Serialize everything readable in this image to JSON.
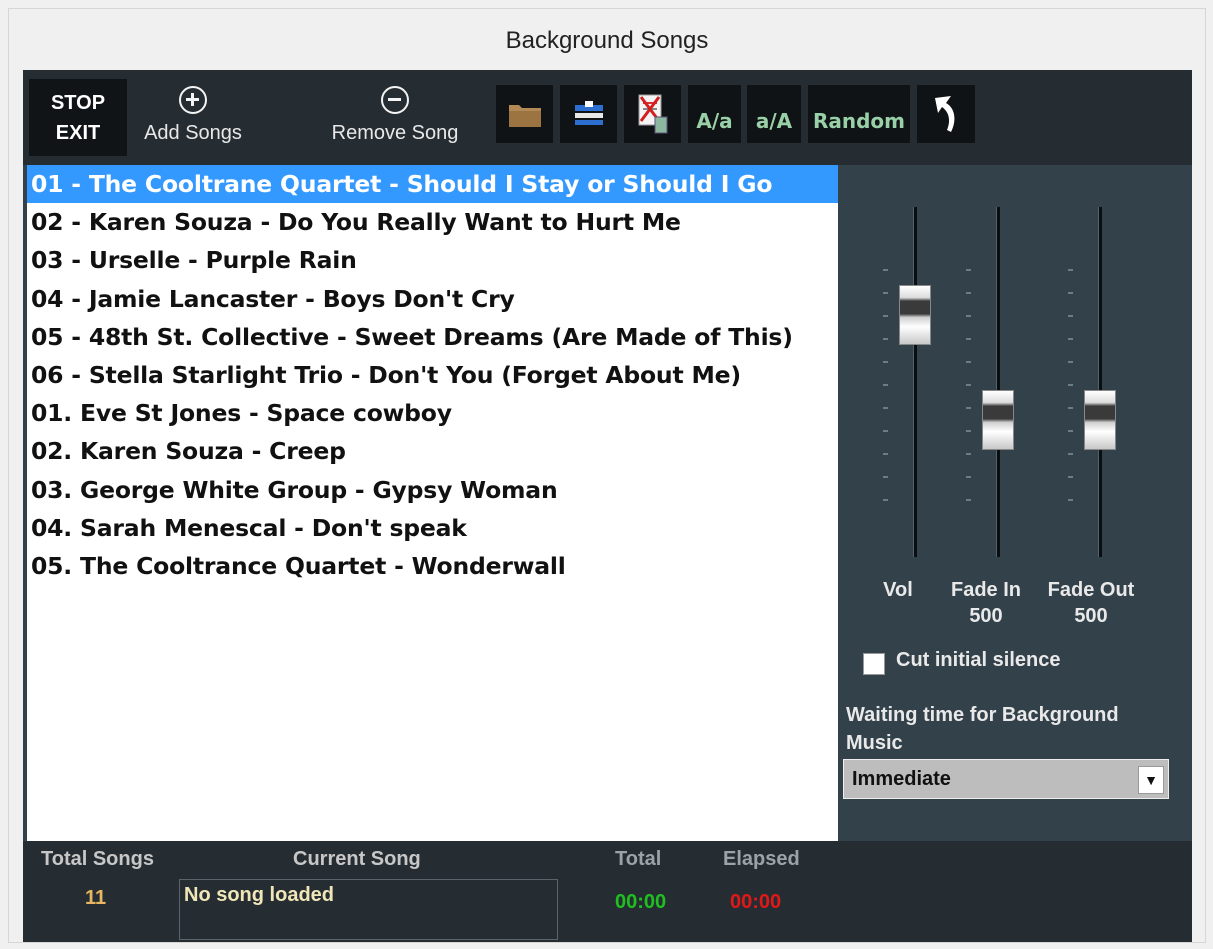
{
  "window": {
    "title": "Background Songs"
  },
  "toolbar": {
    "stop_line1": "STOP",
    "stop_line2": "EXIT",
    "add_songs": "Add Songs",
    "remove_song": "Remove Song",
    "icons": [
      "folder-icon",
      "playlist-icon",
      "clear-list-icon",
      "undo-icon"
    ],
    "case_upper": "A/a",
    "case_lower": "a/A",
    "random": "Random"
  },
  "songs": [
    "01 - The Cooltrane Quartet - Should I Stay or Should I Go",
    "02 - Karen Souza - Do You Really Want to Hurt Me",
    "03 - Urselle - Purple Rain",
    "04 - Jamie Lancaster - Boys Don't Cry",
    "05 - 48th St. Collective - Sweet Dreams (Are Made of This)",
    "06 - Stella Starlight Trio - Don't You (Forget About Me)",
    "01. Eve St Jones - Space cowboy",
    "02. Karen Souza - Creep",
    "03. George White Group - Gypsy Woman",
    "04. Sarah Menescal - Don't speak",
    "05. The Cooltrance Quartet - Wonderwall"
  ],
  "selected_index": 0,
  "sliders": {
    "vol_label": "Vol",
    "vol_level": 0.73,
    "fade_in_label": "Fade In",
    "fade_in_value": "500",
    "fade_in_level": 0.37,
    "fade_out_label": "Fade Out",
    "fade_out_value": "500",
    "fade_out_level": 0.37
  },
  "options": {
    "cut_silence_label": "Cut initial silence",
    "cut_silence_checked": false,
    "waiting_label": "Waiting time for Background Music",
    "waiting_value": "Immediate"
  },
  "status": {
    "total_songs_label": "Total Songs",
    "total_songs_value": "11",
    "current_song_label": "Current Song",
    "current_song_value": "No song loaded",
    "total_label": "Total",
    "total_value": "00:00",
    "elapsed_label": "Elapsed",
    "elapsed_value": "00:00"
  },
  "colors": {
    "selected_row": "#3399ff",
    "total_time": "#1fbf1f",
    "elapsed_time": "#e01818",
    "total_songs_value": "#e8b560"
  }
}
